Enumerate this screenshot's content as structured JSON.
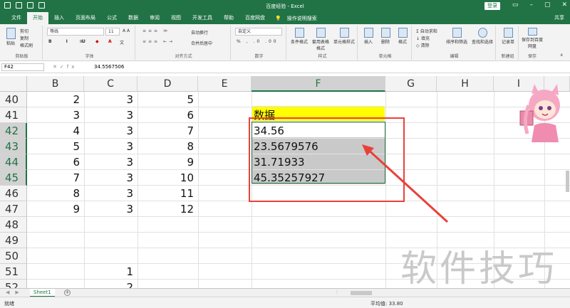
{
  "window": {
    "title": "百度经验 - Excel",
    "login": "登录",
    "share": "共享"
  },
  "tabs": [
    "文件",
    "开始",
    "插入",
    "页面布局",
    "公式",
    "数据",
    "审阅",
    "视图",
    "开发工具",
    "帮助",
    "百度网盘"
  ],
  "tell_me": "操作说明搜索",
  "ribbon": {
    "clipboard": {
      "paste": "粘贴",
      "cut": "剪切",
      "copy": "复制",
      "format_painter": "格式刷",
      "label": "剪贴板"
    },
    "font": {
      "name": "等线",
      "size": "11",
      "label": "字体"
    },
    "alignment": {
      "wrap": "自动换行",
      "merge": "合并后居中",
      "label": "对齐方式"
    },
    "number": {
      "format": "自定义",
      "label": "数字"
    },
    "styles": {
      "conditional": "条件格式",
      "table": "套用表格格式",
      "cell_styles": "单元格样式",
      "label": "样式"
    },
    "cells": {
      "insert": "插入",
      "delete": "删除",
      "format": "格式",
      "label": "单元格"
    },
    "editing": {
      "autosum": "自动求和",
      "fill": "填充",
      "clear": "清除",
      "sort": "排序和筛选",
      "find": "查找和选择",
      "label": "编辑"
    },
    "new_group": {
      "record": "记录单",
      "label": "新建组"
    },
    "save": {
      "save_to": "保存到百度网盘",
      "label": "保存"
    }
  },
  "formula_bar": {
    "name_box": "F42",
    "value": "34.5567506"
  },
  "columns": [
    "B",
    "C",
    "D",
    "E",
    "F",
    "G",
    "H",
    "I"
  ],
  "rows": [
    {
      "num": "40",
      "B": "2",
      "C": "3",
      "D": "5"
    },
    {
      "num": "41",
      "B": "3",
      "C": "3",
      "D": "6",
      "F": "数据"
    },
    {
      "num": "42",
      "B": "4",
      "C": "3",
      "D": "7",
      "F": "34.56"
    },
    {
      "num": "43",
      "B": "5",
      "C": "3",
      "D": "8",
      "F": "23.5679576"
    },
    {
      "num": "44",
      "B": "6",
      "C": "3",
      "D": "9",
      "F": "31.71933"
    },
    {
      "num": "45",
      "B": "7",
      "C": "3",
      "D": "10",
      "F": "45.35257927"
    },
    {
      "num": "46",
      "B": "8",
      "C": "3",
      "D": "11"
    },
    {
      "num": "47",
      "B": "9",
      "C": "3",
      "D": "12"
    },
    {
      "num": "48"
    },
    {
      "num": "49"
    },
    {
      "num": "50"
    },
    {
      "num": "51",
      "C": "1"
    },
    {
      "num": "52",
      "C": "2"
    }
  ],
  "sheet_tab": "Sheet1",
  "status": {
    "ready": "就绪",
    "average": "平均值: 33.80"
  },
  "watermark": "软件技巧",
  "colors": {
    "excel_green": "#217346",
    "highlight_yellow": "#ffff00",
    "annotation_red": "#e8413a"
  }
}
